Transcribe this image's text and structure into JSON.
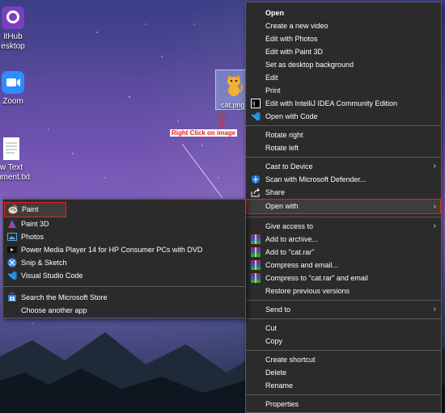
{
  "desktop": {
    "icons": [
      {
        "label": "itHub\nesktop",
        "icon": "github-desktop-icon"
      },
      {
        "label": "Zoom",
        "icon": "zoom-icon"
      },
      {
        "label": "w Text\ncument.txt",
        "icon": "text-file-icon"
      }
    ],
    "selected_file": {
      "label": "cat.png",
      "icon": "cat-image-icon"
    },
    "annotation": "Right Click on image"
  },
  "context_menu": {
    "items": [
      {
        "label": "Open",
        "bold": true
      },
      {
        "label": "Create a new video"
      },
      {
        "label": "Edit with Photos"
      },
      {
        "label": "Edit with Paint 3D"
      },
      {
        "label": "Set as desktop background"
      },
      {
        "label": "Edit"
      },
      {
        "label": "Print"
      },
      {
        "label": "Edit with IntelliJ IDEA Community Edition",
        "icon": "intellij-icon"
      },
      {
        "label": "Open with Code",
        "icon": "vscode-icon"
      },
      {
        "label": "Rotate right"
      },
      {
        "label": "Rotate left"
      },
      {
        "label": "Cast to Device",
        "arrow": true
      },
      {
        "label": "Scan with Microsoft Defender...",
        "icon": "defender-icon"
      },
      {
        "label": "Share",
        "icon": "share-icon"
      },
      {
        "label": "Open with",
        "arrow": true,
        "highlighted": true
      },
      {
        "label": "Give access to",
        "arrow": true
      },
      {
        "label": "Add to archive...",
        "icon": "winrar-icon"
      },
      {
        "label": "Add to \"cat.rar\"",
        "icon": "winrar-icon"
      },
      {
        "label": "Compress and email...",
        "icon": "winrar-icon"
      },
      {
        "label": "Compress to \"cat.rar\" and email",
        "icon": "winrar-icon"
      },
      {
        "label": "Restore previous versions"
      },
      {
        "label": "Send to",
        "arrow": true
      },
      {
        "label": "Cut"
      },
      {
        "label": "Copy"
      },
      {
        "label": "Create shortcut"
      },
      {
        "label": "Delete"
      },
      {
        "label": "Rename"
      },
      {
        "label": "Properties"
      }
    ]
  },
  "open_with_menu": {
    "items": [
      {
        "label": "Paint",
        "icon": "paint-icon",
        "highlighted": true
      },
      {
        "label": "Paint 3D",
        "icon": "paint3d-icon"
      },
      {
        "label": "Photos",
        "icon": "photos-icon"
      },
      {
        "label": "Power Media Player 14 for HP Consumer PCs with DVD",
        "icon": "power-media-player-icon"
      },
      {
        "label": "Snip & Sketch",
        "icon": "snip-sketch-icon"
      },
      {
        "label": "Visual Studio Code",
        "icon": "vscode-icon"
      },
      {
        "label": "Search the Microsoft Store",
        "icon": "store-icon"
      },
      {
        "label": "Choose another app"
      }
    ]
  },
  "colors": {
    "annotation_red": "#e2231a",
    "menu_bg": "#2b2b2b"
  }
}
